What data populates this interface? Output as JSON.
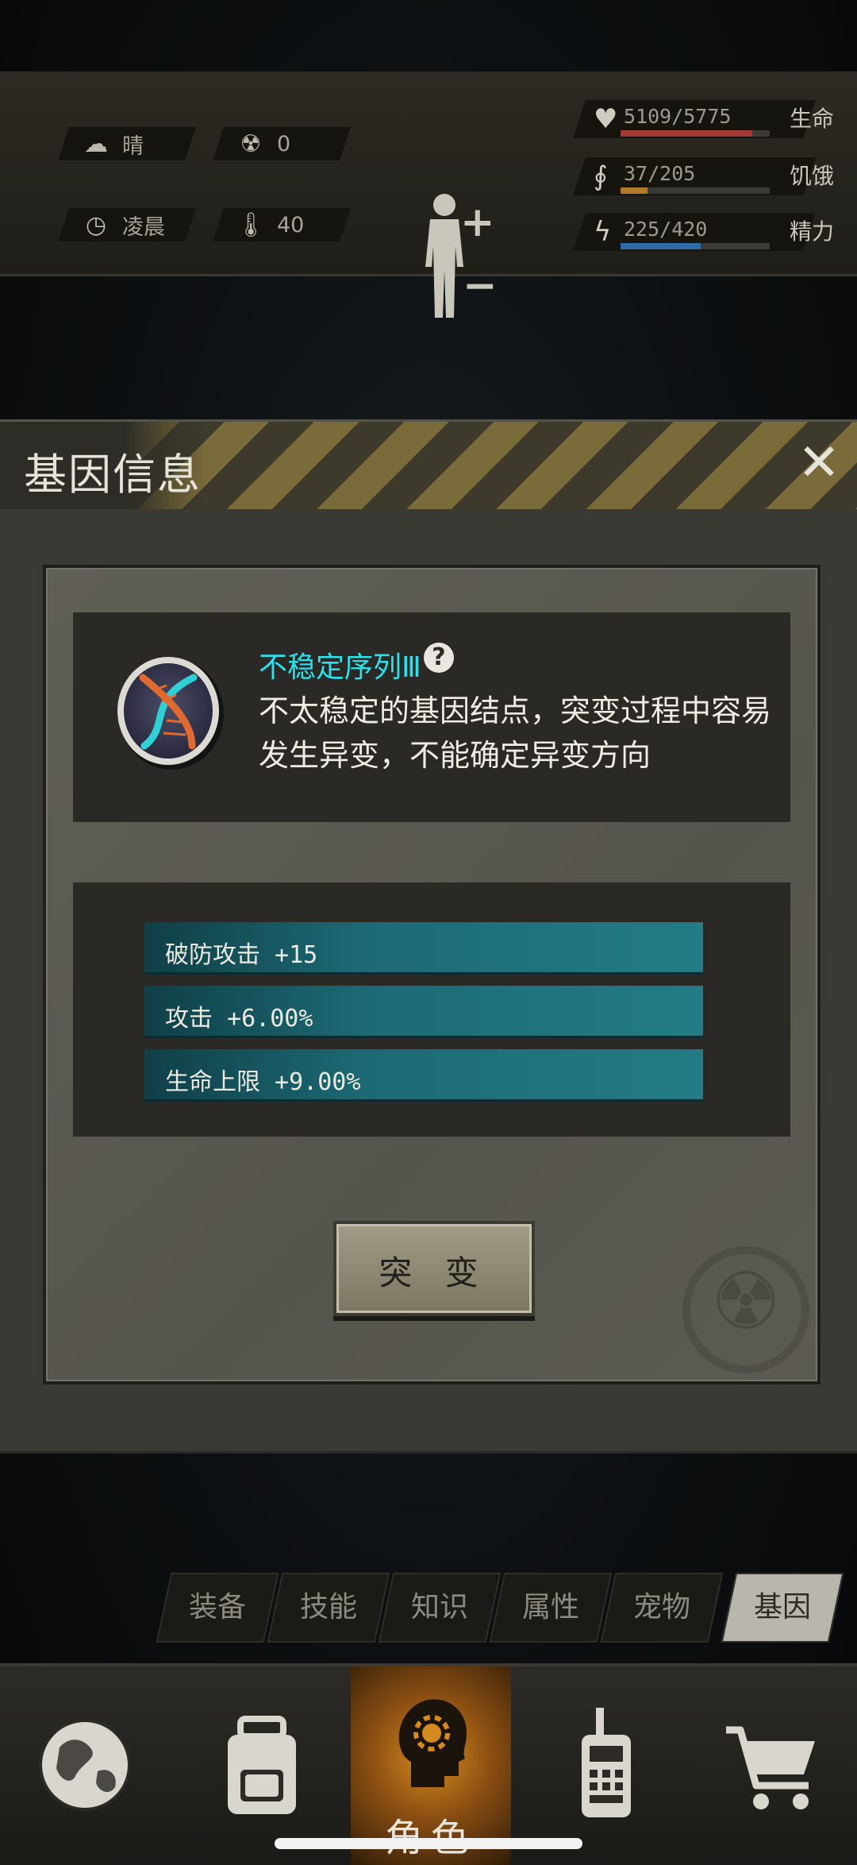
{
  "status": {
    "weather_label": "晴",
    "radiation_value": "0",
    "time_label": "凌晨",
    "temperature_value": "40"
  },
  "vitals": [
    {
      "value_text": "5109/5775",
      "name": "生命",
      "fraction": 0.885,
      "color": "#a43a35",
      "icon": "heart-icon"
    },
    {
      "value_text": "37/205",
      "name": "饥饿",
      "fraction": 0.18,
      "color": "#b07a28",
      "icon": "stomach-icon"
    },
    {
      "value_text": "225/420",
      "name": "精力",
      "fraction": 0.536,
      "color": "#2f6aa8",
      "icon": "energy-icon"
    }
  ],
  "dialog": {
    "title": "基因信息",
    "gene_name": "不稳定序列Ⅲ",
    "help_symbol": "?",
    "description": "不太稳定的基因结点，突变过程中容易发生异变，不能确定异变方向",
    "attributes": [
      "破防攻击 +15",
      "攻击 +6.00%",
      "生命上限 +9.00%"
    ],
    "mutate_button": "突 变"
  },
  "tabs": [
    {
      "label": "装备",
      "active": false
    },
    {
      "label": "技能",
      "active": false
    },
    {
      "label": "知识",
      "active": false
    },
    {
      "label": "属性",
      "active": false
    },
    {
      "label": "宠物",
      "active": false
    },
    {
      "label": "基因",
      "active": true
    }
  ],
  "bottom_nav": {
    "role_label": "角色",
    "items": [
      "globe-icon",
      "backpack-icon",
      "character-icon",
      "radio-icon",
      "shopping-cart-icon"
    ]
  },
  "colors": {
    "gene_name": "#2ee0ea",
    "attr_bar": "#237b86",
    "accent_orange": "#d58a1f"
  }
}
